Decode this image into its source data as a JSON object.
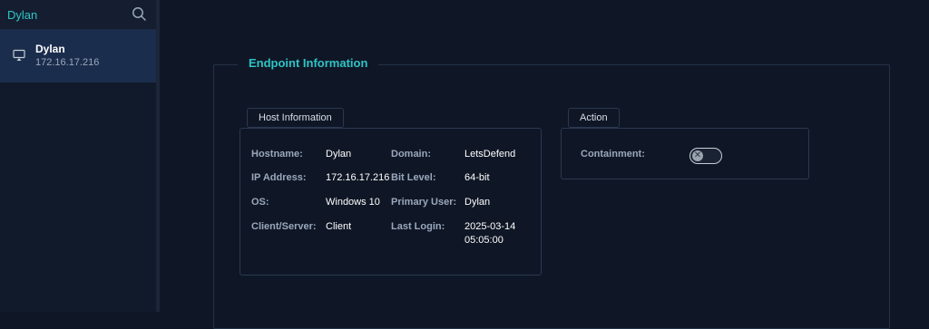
{
  "sidebar": {
    "search": {
      "value": "Dylan",
      "placeholder": "Search"
    },
    "hosts": [
      {
        "name": "Dylan",
        "ip": "172.16.17.216"
      }
    ]
  },
  "endpoint": {
    "title": "Endpoint Information",
    "host_info": {
      "tab_label": "Host Information",
      "fields": {
        "hostname": {
          "label": "Hostname:",
          "value": "Dylan"
        },
        "domain": {
          "label": "Domain:",
          "value": "LetsDefend"
        },
        "ip": {
          "label": "IP Address:",
          "value": "172.16.17.216"
        },
        "bit_level": {
          "label": "Bit Level:",
          "value": "64-bit"
        },
        "os": {
          "label": "OS:",
          "value": "Windows 10"
        },
        "primary_user": {
          "label": "Primary User:",
          "value": "Dylan"
        },
        "client_server": {
          "label": "Client/Server:",
          "value": "Client"
        },
        "last_login": {
          "label": "Last Login:",
          "value_date": "2025-03-14",
          "value_time": "05:05:00"
        }
      }
    },
    "action": {
      "tab_label": "Action",
      "containment": {
        "label": "Containment:",
        "enabled": false
      }
    }
  },
  "colors": {
    "accent": "#2ec4c6",
    "background": "#0f1726",
    "selected": "#1b2d4c"
  }
}
